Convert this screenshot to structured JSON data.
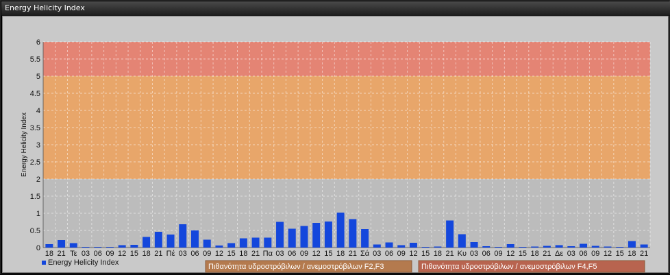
{
  "window": {
    "title": "Energy Helicity Index"
  },
  "legend": {
    "series_label": "Energy Helicity Index"
  },
  "bands": [
    {
      "label": "Πιθανότητα υδροστρόβιλων / ανεμοστρόβιλων F2,F3",
      "from": 2,
      "to": 5,
      "color": "#e8a66a"
    },
    {
      "label": "Πιθανότητα υδροστρόβιλων / ανεμοστρόβιλων F4,F5",
      "from": 5,
      "to": 6,
      "color": "#e48474"
    }
  ],
  "chart_data": {
    "type": "bar",
    "title": "Energy Helicity Index",
    "ylabel": "Energy Helicity Index",
    "xlabel": "",
    "ylim": [
      0,
      6
    ],
    "yticks": [
      "0",
      "0.5",
      "1",
      "1.5",
      "2",
      "2.5",
      "3",
      "3.5",
      "4",
      "4.5",
      "5",
      "5.5",
      "6"
    ],
    "grid": true,
    "legend_position": "bottom-left",
    "bar_color": "#1447dc",
    "categories": [
      "18",
      "21",
      "Τε",
      "03",
      "06",
      "09",
      "12",
      "15",
      "18",
      "21",
      "Πέ",
      "03",
      "06",
      "09",
      "12",
      "15",
      "18",
      "21",
      "Πα",
      "03",
      "06",
      "09",
      "12",
      "15",
      "18",
      "21",
      "Σά",
      "03",
      "06",
      "09",
      "12",
      "15",
      "18",
      "21",
      "Κυ",
      "03",
      "06",
      "09",
      "12",
      "15",
      "18",
      "21",
      "Δε",
      "03",
      "06",
      "09",
      "12",
      "15",
      "18",
      "21"
    ],
    "series": [
      {
        "name": "Energy Helicity Index",
        "values": [
          0.1,
          0.22,
          0.13,
          0.02,
          0.02,
          0.02,
          0.07,
          0.08,
          0.31,
          0.46,
          0.38,
          0.68,
          0.5,
          0.23,
          0.06,
          0.13,
          0.27,
          0.29,
          0.29,
          0.75,
          0.55,
          0.63,
          0.72,
          0.76,
          1.02,
          0.83,
          0.54,
          0.09,
          0.15,
          0.07,
          0.14,
          0.02,
          0.03,
          0.79,
          0.39,
          0.16,
          0.04,
          0.02,
          0.1,
          0.02,
          0.03,
          0.05,
          0.07,
          0.04,
          0.11,
          0.05,
          0.03,
          0.02,
          0.19,
          0.09
        ]
      }
    ]
  }
}
